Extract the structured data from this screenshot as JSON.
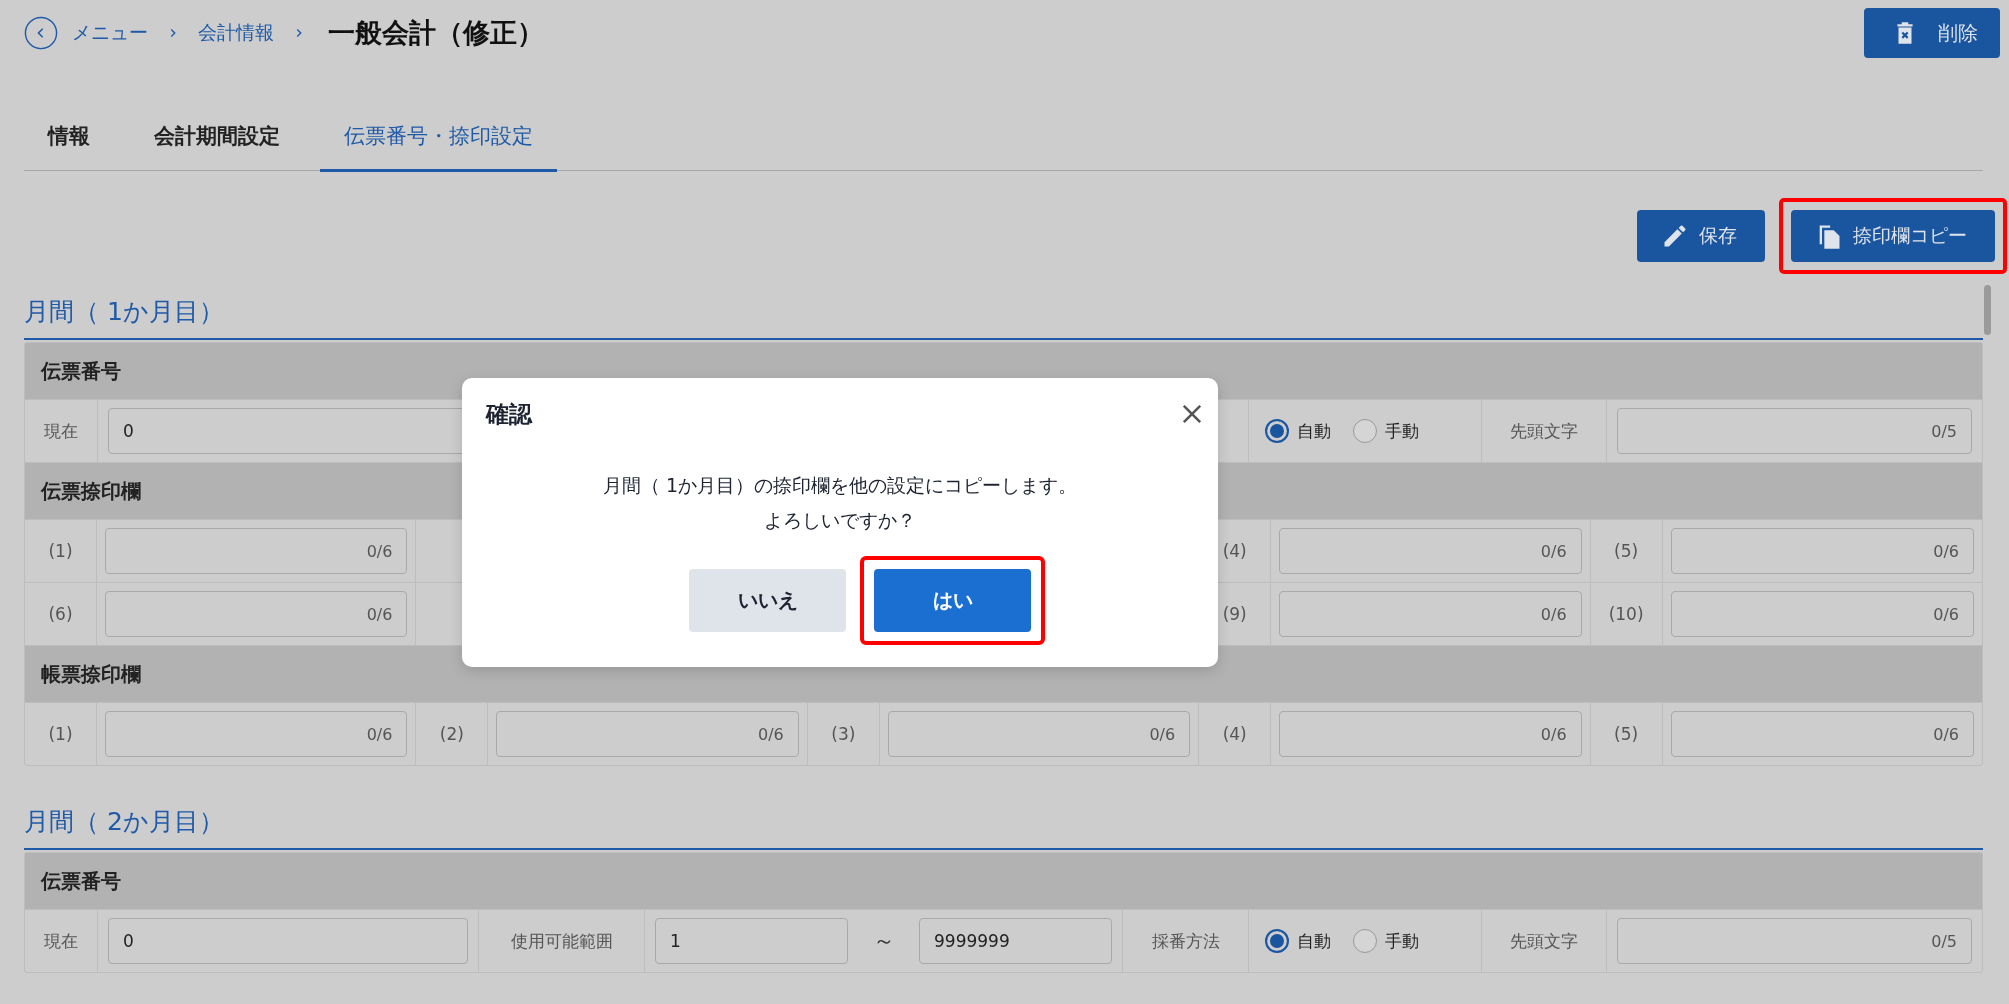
{
  "breadcrumb": {
    "items": [
      {
        "label": "メニュー"
      },
      {
        "label": "会計情報"
      }
    ],
    "title": "一般会計（修正）"
  },
  "header_buttons": [
    {
      "label": "削除",
      "kind": "delete"
    }
  ],
  "tabs": [
    {
      "label": "情報",
      "selected": false
    },
    {
      "label": "会計期間設定",
      "selected": false
    },
    {
      "label": "伝票番号・捺印設定",
      "selected": true
    }
  ],
  "toolbar_buttons": [
    {
      "label": "保存",
      "kind": "save",
      "highlighted": false
    },
    {
      "label": "捺印欄コピー",
      "kind": "copy",
      "highlighted": true
    }
  ],
  "sections": [
    {
      "title": "月間（ 1か月目）",
      "groups": [
        {
          "kind": "number",
          "title": "伝票番号",
          "cells": [
            {
              "kind": "label",
              "text": "現在"
            },
            {
              "kind": "field",
              "value": "0"
            },
            {
              "kind": "covered"
            },
            {
              "kind": "radios",
              "options": [
                {
                  "label": "自動",
                  "selected": true
                },
                {
                  "label": "手動",
                  "selected": false
                }
              ]
            },
            {
              "kind": "label",
              "text": "先頭文字"
            },
            {
              "kind": "counter_field",
              "counter": "0/5"
            }
          ]
        },
        {
          "kind": "stamps",
          "title": "伝票捺印欄",
          "rows": [
            [
              {
                "kind": "slot",
                "label": "(1)",
                "counter": "0/6"
              },
              {
                "kind": "covered"
              },
              {
                "kind": "covered"
              },
              {
                "kind": "slot",
                "label": "(4)",
                "counter": "0/6"
              },
              {
                "kind": "slot",
                "label": "(5)",
                "counter": "0/6"
              }
            ],
            [
              {
                "kind": "slot",
                "label": "(6)",
                "counter": "0/6"
              },
              {
                "kind": "covered"
              },
              {
                "kind": "covered"
              },
              {
                "kind": "slot",
                "label": "(9)",
                "counter": "0/6"
              },
              {
                "kind": "slot",
                "label": "(10)",
                "counter": "0/6"
              }
            ]
          ]
        },
        {
          "kind": "stamps",
          "title": "帳票捺印欄",
          "rows": [
            [
              {
                "kind": "slot",
                "label": "(1)",
                "counter": "0/6"
              },
              {
                "kind": "slot",
                "label": "(2)",
                "counter": "0/6"
              },
              {
                "kind": "slot",
                "label": "(3)",
                "counter": "0/6"
              },
              {
                "kind": "slot",
                "label": "(4)",
                "counter": "0/6"
              },
              {
                "kind": "slot",
                "label": "(5)",
                "counter": "0/6"
              }
            ]
          ]
        }
      ]
    },
    {
      "title": "月間（ 2か月目）",
      "groups": [
        {
          "kind": "number",
          "title": "伝票番号",
          "cells": [
            {
              "kind": "label",
              "text": "現在"
            },
            {
              "kind": "field",
              "value": "0"
            },
            {
              "kind": "label",
              "text": "使用可能範囲"
            },
            {
              "kind": "field",
              "value": "1"
            },
            {
              "kind": "separator",
              "text": "～"
            },
            {
              "kind": "field",
              "value": "9999999"
            },
            {
              "kind": "label",
              "text": "採番方法"
            },
            {
              "kind": "radios",
              "options": [
                {
                  "label": "自動",
                  "selected": true
                },
                {
                  "label": "手動",
                  "selected": false
                }
              ]
            },
            {
              "kind": "label",
              "text": "先頭文字"
            },
            {
              "kind": "counter_field",
              "counter": "0/5"
            }
          ]
        }
      ]
    }
  ],
  "dialog": {
    "title": "確認",
    "message": [
      "月間（ 1か月目）の捺印欄を他の設定にコピーします。",
      "よろしいですか？"
    ],
    "buttons": [
      {
        "label": "いいえ",
        "kind": "secondary",
        "highlighted": false
      },
      {
        "label": "はい",
        "kind": "primary",
        "highlighted": true
      }
    ]
  }
}
